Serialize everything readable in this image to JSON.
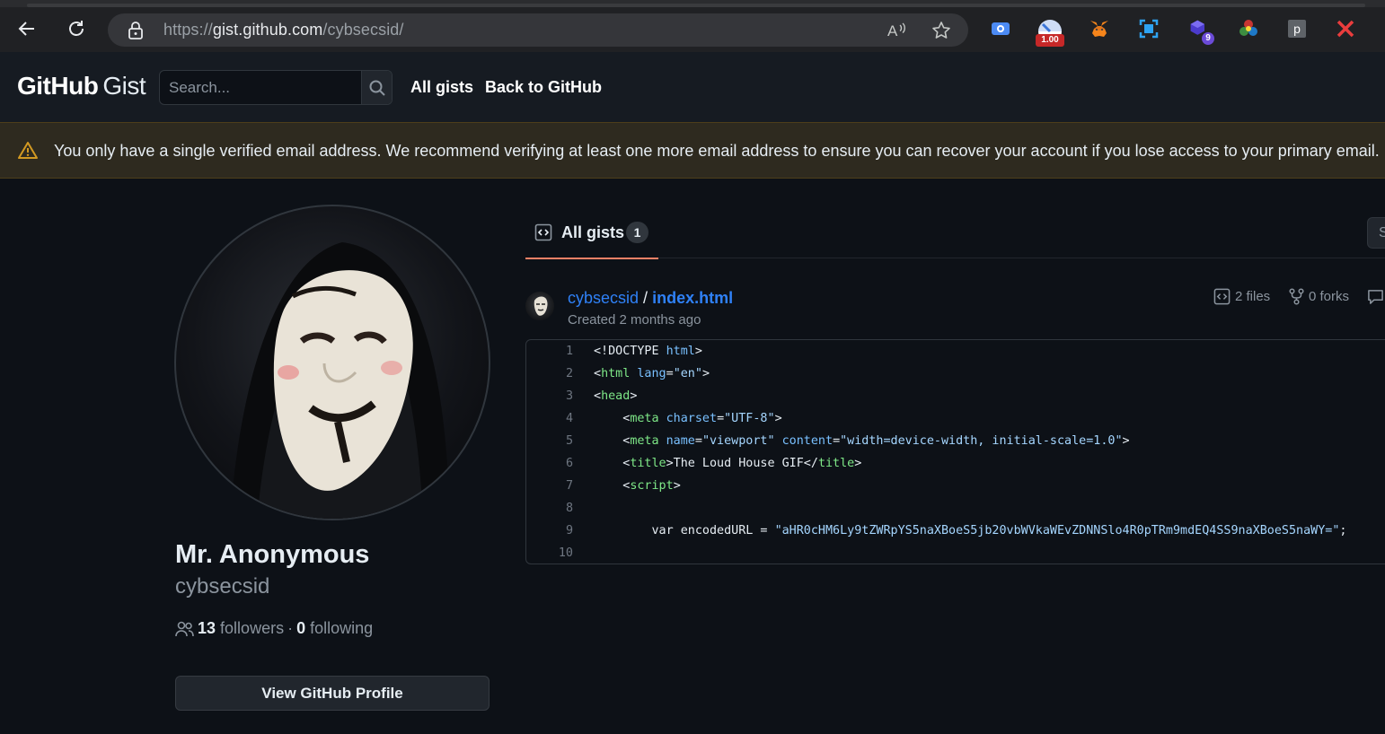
{
  "browser": {
    "url_prefix": "https://",
    "url_host": "gist.github.com",
    "url_path": "/cybsecsid/",
    "extension_badge_1": "1.00",
    "extension_badge_2": "9",
    "extension_letter": "p"
  },
  "header": {
    "logo_main": "GitHub",
    "logo_sub": "Gist",
    "search_placeholder": "Search...",
    "nav_all_gists": "All gists",
    "nav_back": "Back to GitHub"
  },
  "flash": {
    "message": "You only have a single verified email address. We recommend verifying at least one more email address to ensure you can recover your account if you lose access to your primary email."
  },
  "profile": {
    "name": "Mr. Anonymous",
    "login": "cybsecsid",
    "followers_count": "13",
    "followers_label": "followers",
    "dot": "·",
    "following_count": "0",
    "following_label": "following",
    "view_profile_label": "View GitHub Profile"
  },
  "tabs": {
    "all_gists_label": "All gists",
    "all_gists_count": "1",
    "edge_button_letter": "S"
  },
  "gist": {
    "owner": "cybsecsid",
    "separator": "/",
    "filename": "index.html",
    "created": "Created 2 months ago",
    "files": "2 files",
    "forks": "0 forks"
  },
  "code_lines": [
    {
      "n": "1",
      "html": "<span class='p'>&lt;!DOCTYPE </span><span class='a'>html</span><span class='p'>&gt;</span>"
    },
    {
      "n": "2",
      "html": "<span class='p'>&lt;</span><span class='t'>html</span> <span class='a'>lang</span><span class='p'>=</span><span class='s'>\"en\"</span><span class='p'>&gt;</span>"
    },
    {
      "n": "3",
      "html": "<span class='p'>&lt;</span><span class='t'>head</span><span class='p'>&gt;</span>"
    },
    {
      "n": "4",
      "html": "    <span class='p'>&lt;</span><span class='t'>meta</span> <span class='a'>charset</span><span class='p'>=</span><span class='s'>\"UTF-8\"</span><span class='p'>&gt;</span>"
    },
    {
      "n": "5",
      "html": "    <span class='p'>&lt;</span><span class='t'>meta</span> <span class='a'>name</span><span class='p'>=</span><span class='s'>\"viewport\"</span> <span class='a'>content</span><span class='p'>=</span><span class='s'>\"width=device-width, initial-scale=1.0\"</span><span class='p'>&gt;</span>"
    },
    {
      "n": "6",
      "html": "    <span class='p'>&lt;</span><span class='t'>title</span><span class='p'>&gt;The Loud House GIF&lt;/</span><span class='t'>title</span><span class='p'>&gt;</span>"
    },
    {
      "n": "7",
      "html": "    <span class='p'>&lt;</span><span class='t'>script</span><span class='p'>&gt;</span>"
    },
    {
      "n": "8",
      "html": ""
    },
    {
      "n": "9",
      "html": "        <span class='p'>var encodedURL = </span><span class='s'>\"aHR0cHM6Ly9tZWRpYS5naXBoeS5jb20vbWVkaWEvZDNNSlo4R0pTRm9mdEQ4SS9naXBoeS5naWY=\"</span><span class='p'>;</span>"
    },
    {
      "n": "10",
      "html": ""
    }
  ],
  "colors": {
    "accent_link": "#2f81f7",
    "tab_underline": "#f78166",
    "warning": "#d29922"
  }
}
